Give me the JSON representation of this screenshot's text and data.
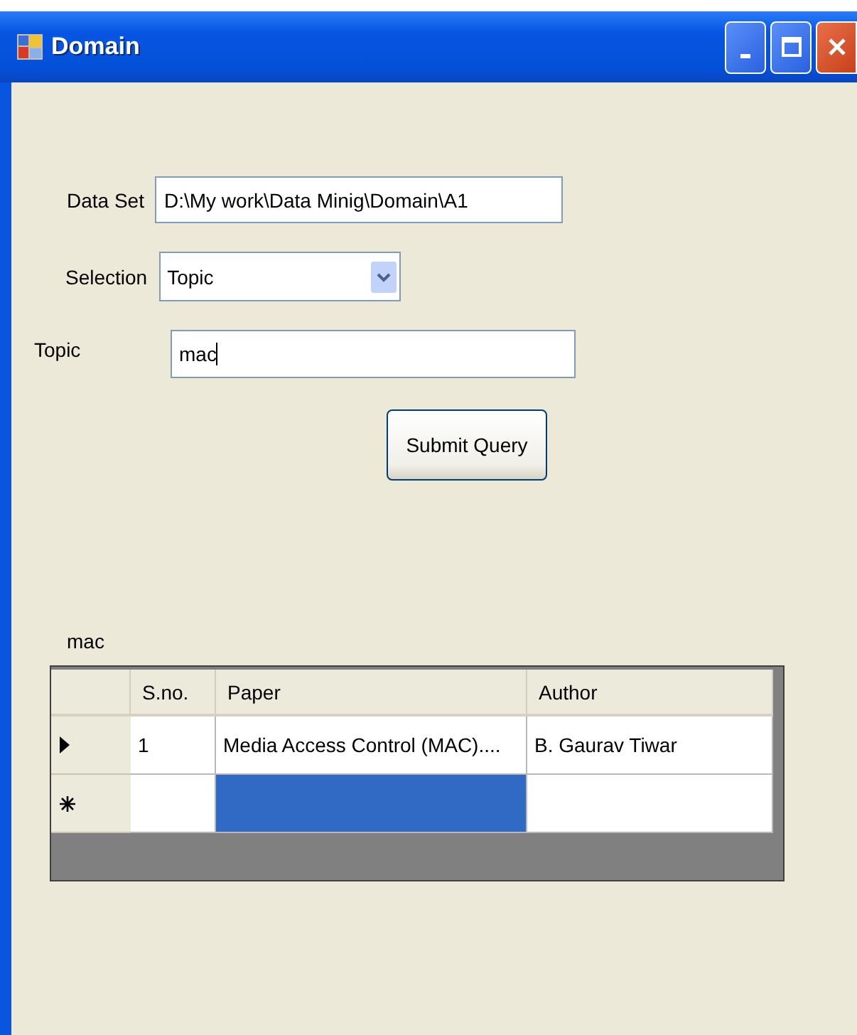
{
  "window": {
    "title": "Domain"
  },
  "form": {
    "data_set": {
      "label": "Data Set",
      "value": "D:\\My work\\Data Minig\\Domain\\A1"
    },
    "selection": {
      "label": "Selection",
      "value": "Topic"
    },
    "topic": {
      "label": "Topic",
      "value": "mac"
    }
  },
  "submit_button": "Submit Query",
  "result_label": "mac",
  "grid": {
    "columns": [
      "S.no.",
      "Paper",
      "Author"
    ],
    "rows": [
      {
        "kind": "current",
        "cells": [
          {
            "text": "1",
            "selected": false
          },
          {
            "text": "Media Access Control (MAC)....",
            "selected": false
          },
          {
            "text": "B. Gaurav Tiwar",
            "selected": false
          }
        ]
      },
      {
        "kind": "new",
        "cells": [
          {
            "selected": false
          },
          {
            "selected": true
          },
          {
            "selected": false
          }
        ]
      }
    ]
  }
}
